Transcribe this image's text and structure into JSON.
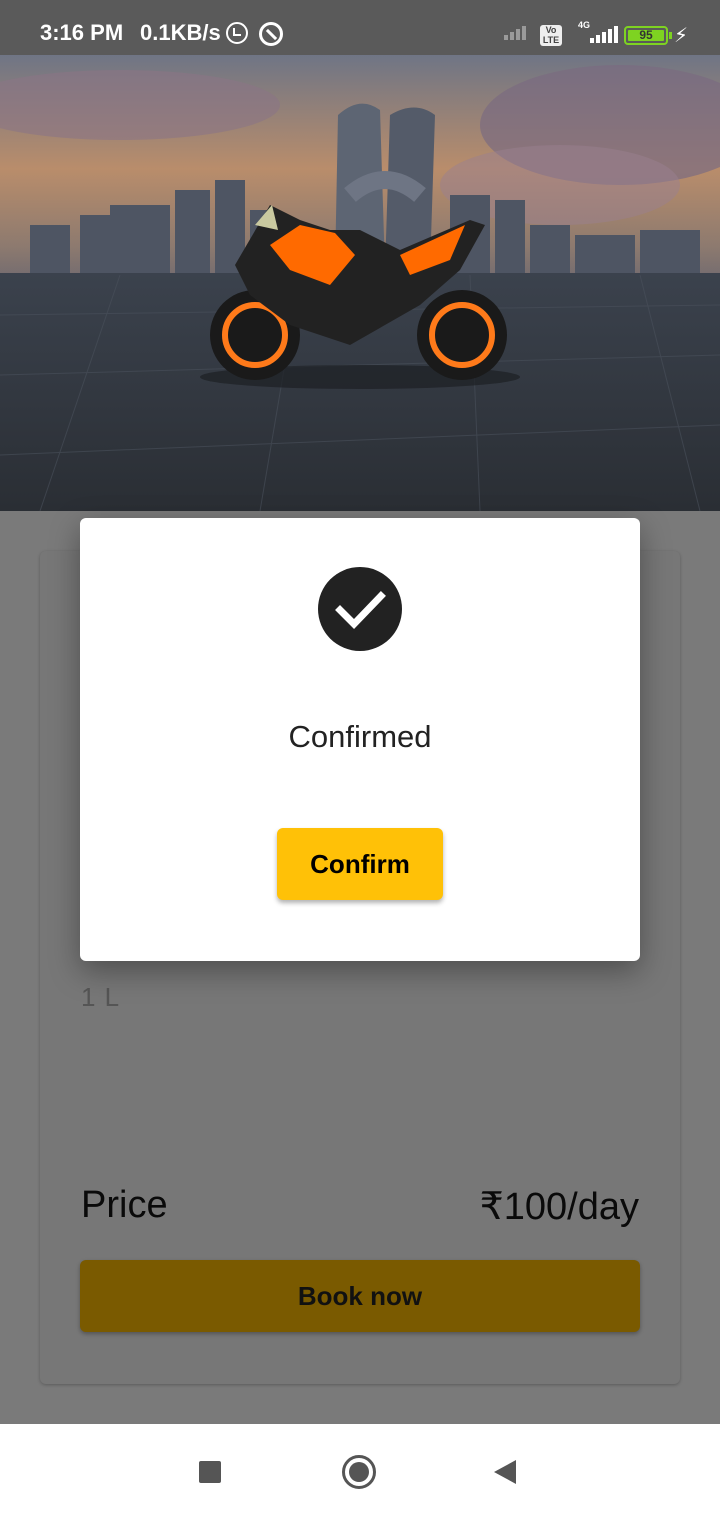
{
  "status_bar": {
    "time": "3:16 PM",
    "network_speed": "0.1KB/s",
    "volte_label": "Vo LTE",
    "network_type": "4G",
    "battery_level": "95"
  },
  "hero": {
    "image_icon": "motorcycle-city-photo"
  },
  "card": {
    "spec_text": "1 L",
    "price_label": "Price",
    "price_value": "₹100/day",
    "book_label": "Book now"
  },
  "dialog": {
    "icon": "check-circle-icon",
    "title": "Confirmed",
    "confirm_label": "Confirm"
  },
  "colors": {
    "accent": "#ffc107",
    "scrim": "#7a7a7a",
    "book_button_dimmed": "#7a5a00"
  }
}
